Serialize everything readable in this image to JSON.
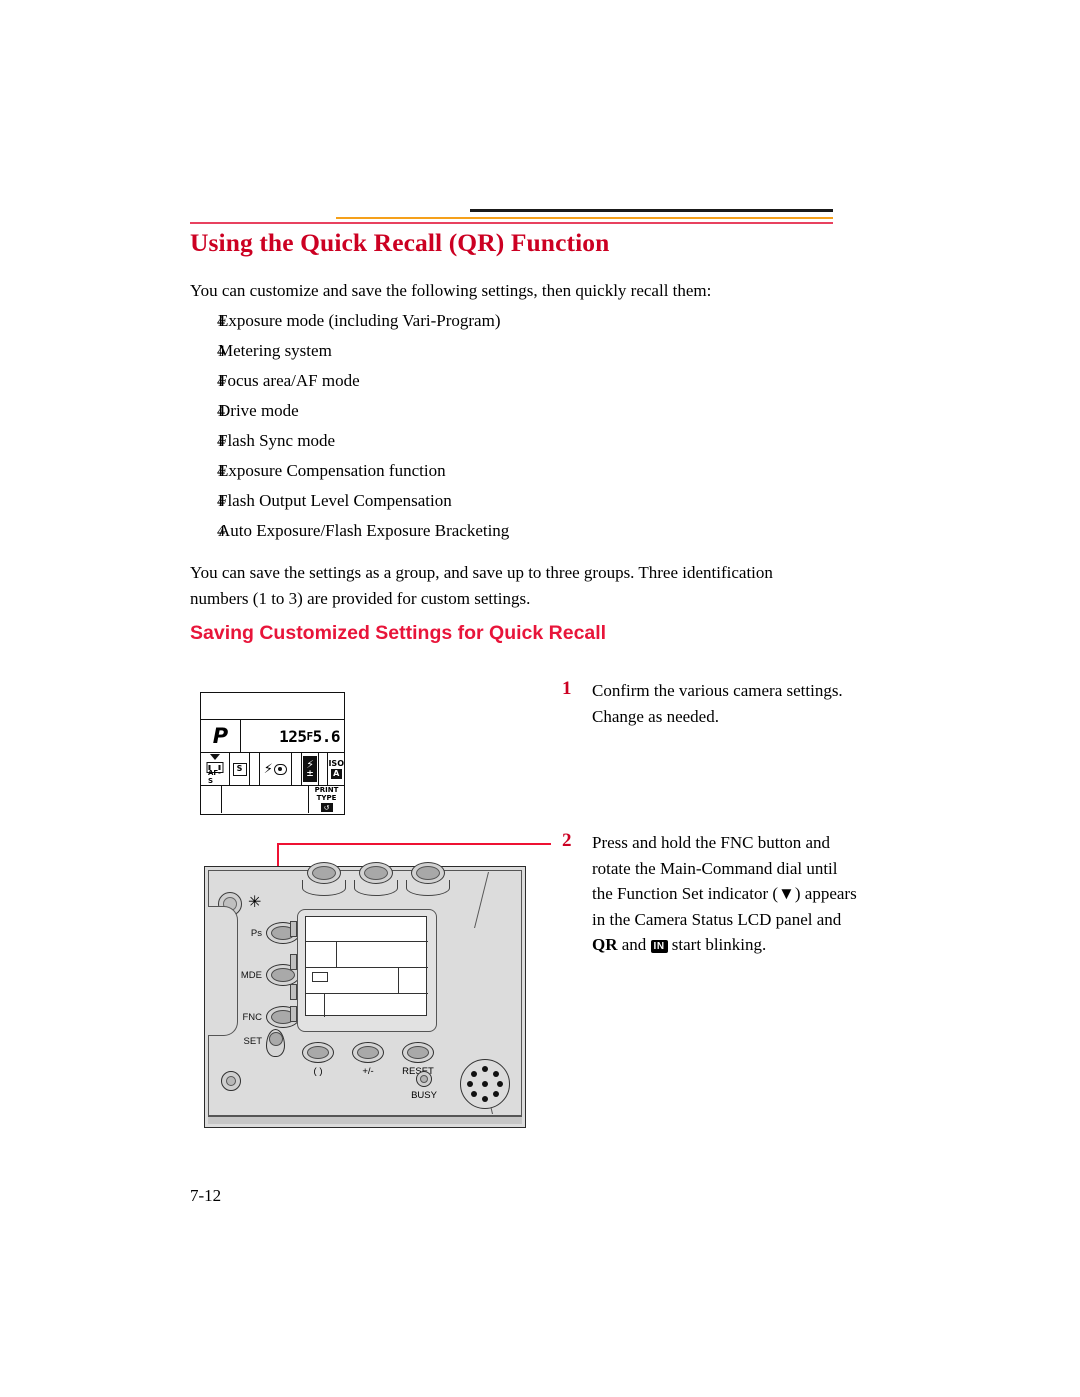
{
  "page": {
    "folio": "7-12"
  },
  "heading": {
    "title": "Using the Quick Recall (QR) Function",
    "subheading": "Saving Customized Settings for Quick Recall"
  },
  "intro": "You can customize and save the following settings, then quickly recall them:",
  "bullet_mark": "4",
  "bullets": [
    "Exposure mode (including Vari-Program)",
    "Metering system",
    "Focus area/AF mode",
    "Drive mode",
    "Flash Sync mode",
    "Exposure Compensation function",
    "Flash Output Level Compensation",
    "Auto Exposure/Flash Exposure Bracketing"
  ],
  "paragraph": "You can save the settings as a group, and save up to three groups. Three identification numbers (1 to 3) are provided for custom settings.",
  "steps": [
    {
      "number": "1",
      "text": "Confirm the various camera settings. Change as needed."
    },
    {
      "number": "2",
      "text_part1": "Press and hold the FNC button and rotate the Main-Command dial until the Function Set indicator (",
      "arrow_glyph": "▼",
      "text_part2": ") appears in the Camera Status LCD panel and ",
      "bold_qr": "QR",
      "text_part3": " and ",
      "badge_label": "IN",
      "text_part4": " start blinking."
    }
  ],
  "lcd_panel": {
    "exposure_mode": "P",
    "shutter_speed": "125",
    "aperture_prefix": "F",
    "aperture": "5.6",
    "focus_area_label": "AF-S",
    "drive_mode": "S",
    "flash_bolt": "⚡",
    "flash_comp_top": "⚡",
    "flash_comp_bottom": "±",
    "iso_label": "ISO",
    "iso_value": "A",
    "print_label": "PRINT\nTYPE",
    "print_icon": "↺"
  },
  "camera_back": {
    "viewfinder_mark": "✳",
    "buttons": [
      {
        "label": "Ps"
      },
      {
        "label": "MDE"
      },
      {
        "label": "FNC"
      },
      {
        "label": "SET"
      }
    ],
    "bottom_buttons": [
      {
        "label": "( )"
      },
      {
        "label": "+/-"
      },
      {
        "label": "RESET"
      }
    ],
    "busy_label": "BUSY"
  },
  "colors": {
    "heading_red": "#cc0022",
    "subheading_red": "#e8153a",
    "rule_orange": "#f5a01a",
    "rule_red": "#e8415f",
    "rule_black": "#1a1a1a",
    "leader_red": "#ee1133",
    "body_gray": "#dcdcdc"
  }
}
